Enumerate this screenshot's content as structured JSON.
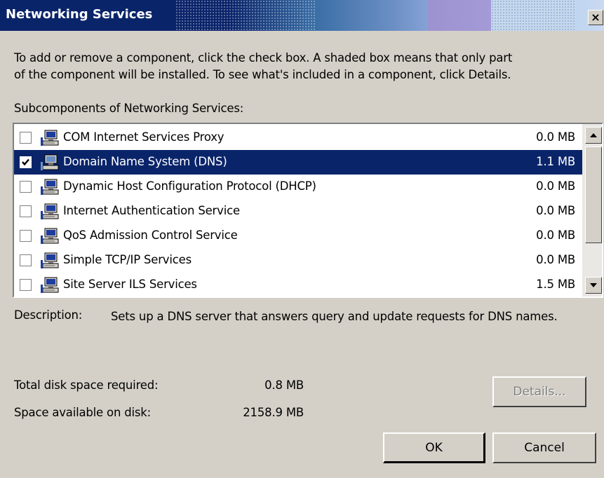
{
  "window": {
    "title": "Networking Services",
    "close_symbol": "×"
  },
  "instructions": {
    "line1": "To add or remove a component, click the check box. A shaded box means that only part",
    "line2": "of the component will be installed. To see what's included in a component, click Details."
  },
  "subcomponents_label": "Subcomponents of Networking Services:",
  "components": [
    {
      "label": "COM Internet Services Proxy",
      "size": "0.0 MB",
      "checked": false,
      "selected": false,
      "icon": "network-computer-icon"
    },
    {
      "label": "Domain Name System (DNS)",
      "size": "1.1 MB",
      "checked": true,
      "selected": true,
      "icon": "network-computer-icon"
    },
    {
      "label": "Dynamic Host Configuration Protocol (DHCP)",
      "size": "0.0 MB",
      "checked": false,
      "selected": false,
      "icon": "network-computer-icon"
    },
    {
      "label": "Internet Authentication Service",
      "size": "0.0 MB",
      "checked": false,
      "selected": false,
      "icon": "network-computer-icon"
    },
    {
      "label": "QoS Admission Control Service",
      "size": "0.0 MB",
      "checked": false,
      "selected": false,
      "icon": "network-computer-icon"
    },
    {
      "label": "Simple TCP/IP Services",
      "size": "0.0 MB",
      "checked": false,
      "selected": false,
      "icon": "network-computer-icon"
    },
    {
      "label": "Site Server ILS Services",
      "size": "1.5 MB",
      "checked": false,
      "selected": false,
      "icon": "network-computer-icon"
    }
  ],
  "description": {
    "label": "Description:",
    "text": "Sets up a DNS server that answers query and update requests for DNS names."
  },
  "disk": {
    "required_label": "Total disk space required:",
    "required_value": "0.8 MB",
    "available_label": "Space available on disk:",
    "available_value": "2158.9 MB"
  },
  "buttons": {
    "details": "Details...",
    "ok": "OK",
    "cancel": "Cancel"
  },
  "colors": {
    "selection": "#0a246a",
    "face": "#d4d0c8"
  }
}
